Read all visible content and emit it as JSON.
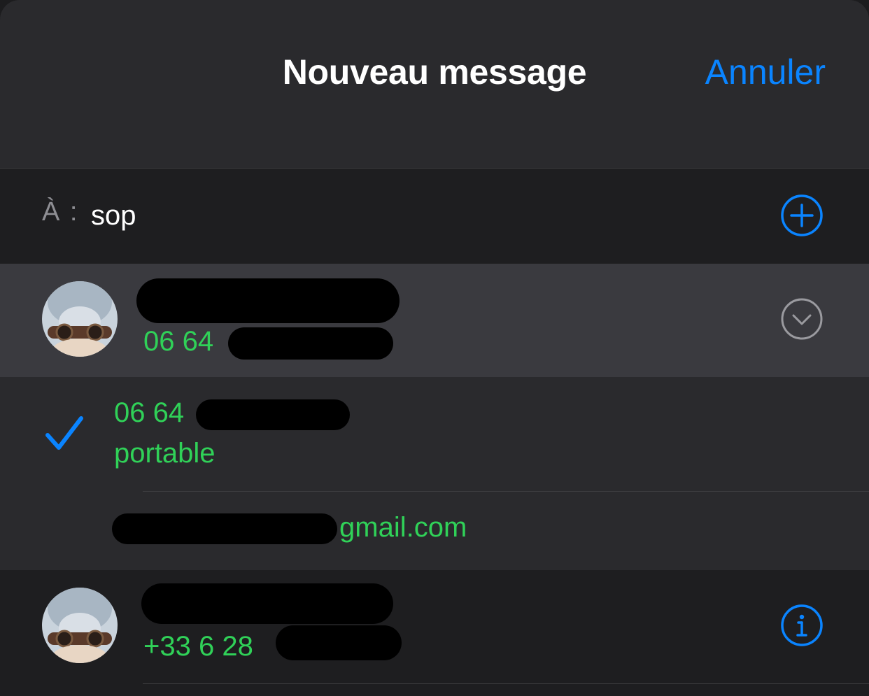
{
  "header": {
    "title": "Nouveau message",
    "cancel_label": "Annuler"
  },
  "recipient": {
    "label": "À :",
    "value": "sop"
  },
  "contacts": [
    {
      "phone_visible": "06 64 ",
      "expanded": true,
      "details": {
        "phone_visible": "06 64 ",
        "phone_type": "portable",
        "email_visible": "gmail.com",
        "selected": "phone"
      }
    },
    {
      "phone_visible": "+33 6 28 "
    }
  ],
  "colors": {
    "accent": "#0a84ff",
    "contact_text": "#30d158",
    "background": "#1c1c1e",
    "header_bg": "#2a2a2d",
    "selected_row_bg": "#3a3a3f"
  },
  "icons": {
    "add": "plus-circle-icon",
    "expand": "chevron-down-circle-icon",
    "selected": "checkmark-icon",
    "info": "info-circle-icon"
  }
}
